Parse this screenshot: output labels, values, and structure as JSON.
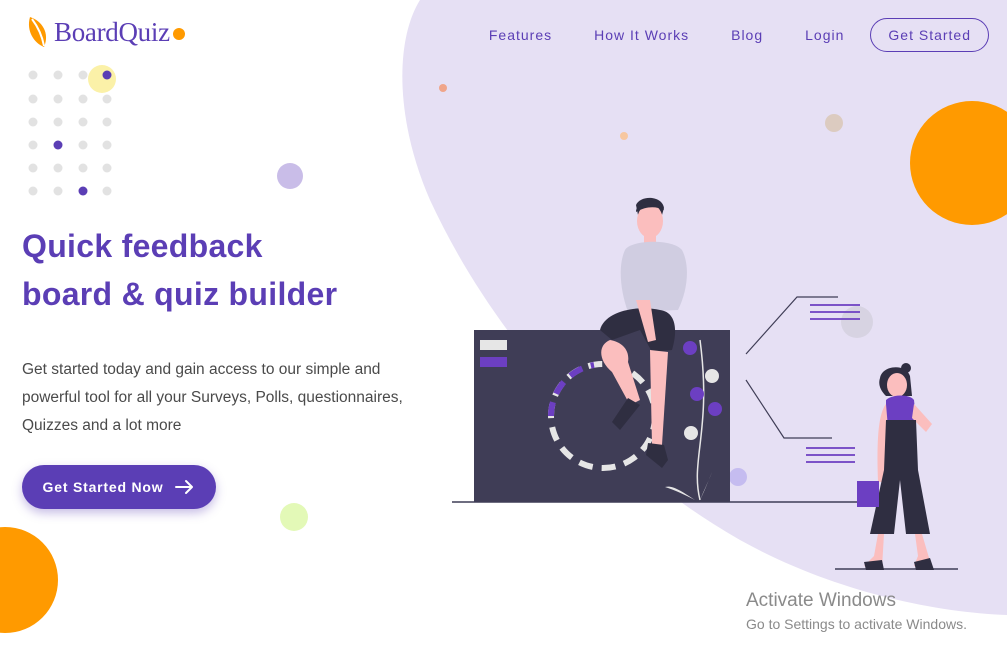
{
  "brand": {
    "name": "BoardQuiz",
    "colors": {
      "primary": "#5b3eb5",
      "accent": "#ff9a00",
      "lavender": "#e6e0f4"
    }
  },
  "nav": {
    "links": [
      "Features",
      "How It Works",
      "Blog",
      "Login"
    ],
    "cta_label": "Get Started"
  },
  "hero": {
    "headline_line1": "Quick feedback",
    "headline_line2": "board & quiz builder",
    "description": "Get started today and gain access to our simple and powerful tool for all your Surveys, Polls, questionnaires, Quizzes and a lot more",
    "cta_label": "Get Started Now",
    "cta_icon": "arrow-right-icon"
  },
  "watermark": {
    "title": "Activate Windows",
    "subtitle": "Go to Settings to activate Windows."
  }
}
